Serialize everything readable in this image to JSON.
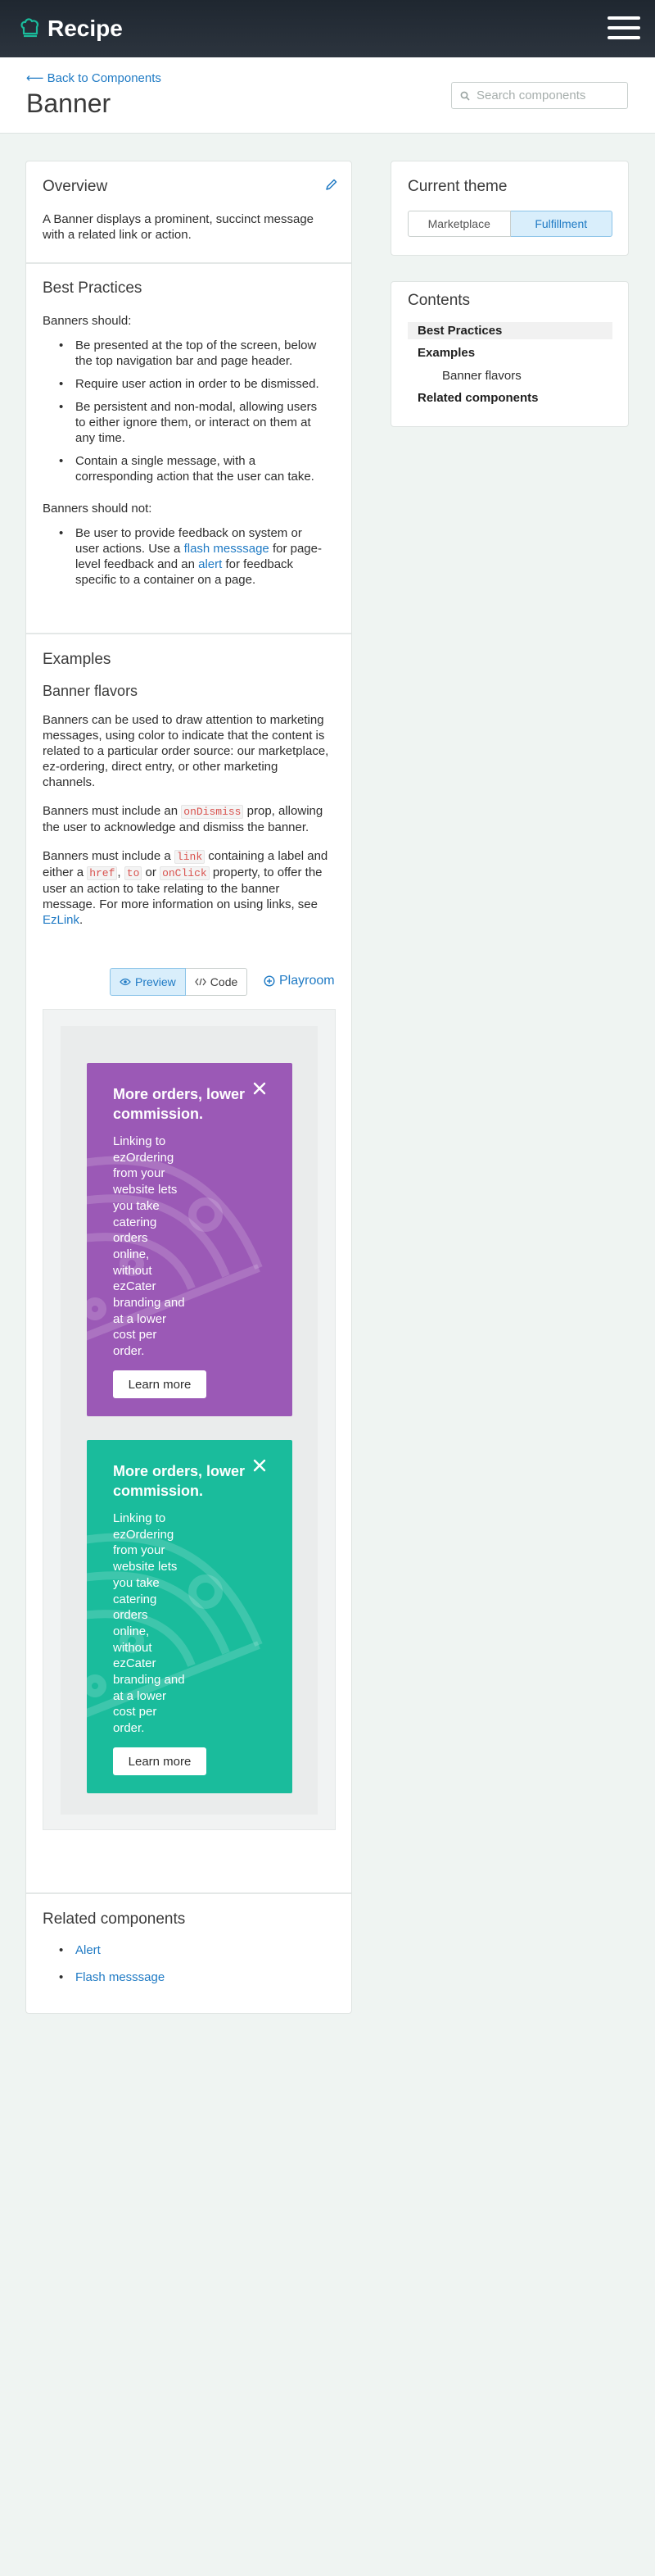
{
  "brand": {
    "name": "Recipe"
  },
  "header": {
    "back_label": "⟵ Back to Components",
    "title": "Banner",
    "search_placeholder": "Search components"
  },
  "overview": {
    "heading": "Overview",
    "text": "A Banner displays a prominent, succinct message with a related link or action."
  },
  "best_practices": {
    "heading": "Best Practices",
    "should_label": "Banners should:",
    "should": [
      "Be presented at the top of the screen, below the top navigation bar and page header.",
      "Require user action in order to be dismissed.",
      "Be persistent and non-modal, allowing users to either ignore them, or interact on them at any time.",
      "Contain a single message, with a corresponding action that the user can take."
    ],
    "should_not_label": "Banners should not:",
    "should_not": {
      "part1": "Be user to provide feedback on system or user actions. Use a ",
      "link1": "flash messsage",
      "part2": " for page-level feedback and an ",
      "link2": "alert",
      "part3": " for feedback specific to a container on a page."
    }
  },
  "examples": {
    "heading": "Examples",
    "subheading": "Banner flavors",
    "p1": "Banners can be used to draw attention to marketing messages, using color to indicate that the content is related to a particular order source: our marketplace, ez-ordering, direct entry, or other marketing channels.",
    "p2_a": "Banners must include an ",
    "p2_code": "onDismiss",
    "p2_b": " prop, allowing the user to acknowledge and dismiss the banner.",
    "p3_a": "Banners must include a ",
    "p3_code1": "link",
    "p3_b": " containing a label and either a ",
    "p3_code2": "href",
    "p3_c": ", ",
    "p3_code3": "to",
    "p3_d": " or ",
    "p3_code4": "onClick",
    "p3_e": " property, to offer the user an action to take relating to the banner message. For more information on using links, see ",
    "p3_link": "EzLink",
    "p3_f": ".",
    "preview_label": "Preview",
    "code_label": "Code",
    "playroom_label": "Playroom"
  },
  "banners": [
    {
      "title": "More orders, lower commission.",
      "body": "Linking to ezOrdering from your website lets you take catering orders online, without ezCater branding and at a lower cost per order.",
      "button": "Learn more",
      "color": "#9b59b6"
    },
    {
      "title": "More orders, lower commission.",
      "body": "Linking to ezOrdering from your website lets you take catering orders online, without ezCater branding and at a lower cost per order.",
      "button": "Learn more",
      "color": "#1abc9c"
    }
  ],
  "related": {
    "heading": "Related components",
    "items": [
      "Alert",
      "Flash messsage"
    ]
  },
  "theme": {
    "heading": "Current theme",
    "options": [
      "Marketplace",
      "Fulfillment"
    ],
    "selected": "Fulfillment"
  },
  "contents": {
    "heading": "Contents",
    "items": [
      "Best Practices",
      "Examples",
      "Banner flavors",
      "Related components"
    ]
  },
  "colors": {
    "link": "#1f7ac4",
    "topbar": "#1f2730",
    "accent": "#1abc9c"
  }
}
